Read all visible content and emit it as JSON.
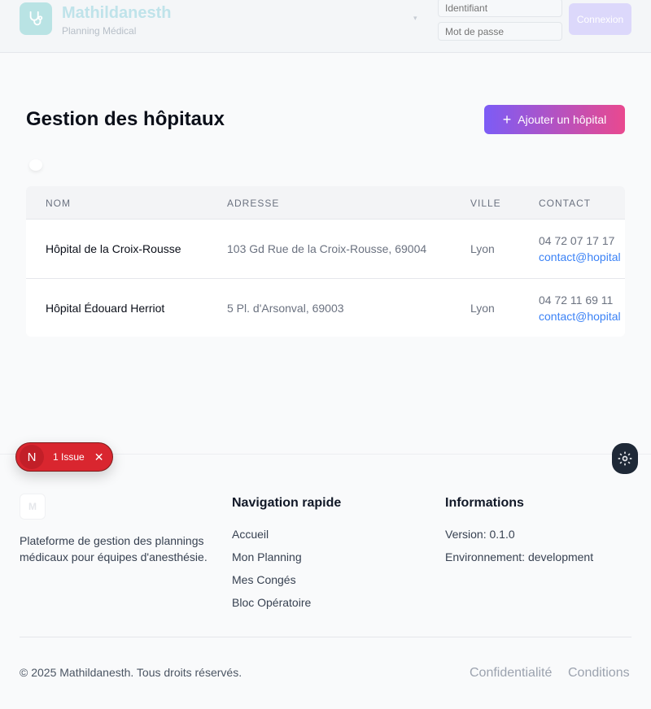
{
  "header": {
    "app_title": "Mathildanesth",
    "app_subtitle": "Planning Médical",
    "username_placeholder": "Identifiant",
    "password_placeholder": "Mot de passe",
    "login_label": "Connexion"
  },
  "page": {
    "title": "Gestion des hôpitaux",
    "add_button_label": "Ajouter un hôpital"
  },
  "table": {
    "headers": [
      "NOM",
      "ADRESSE",
      "VILLE",
      "CONTACT"
    ],
    "rows": [
      {
        "name": "Hôpital de la Croix-Rousse",
        "address": "103 Gd Rue de la Croix-Rousse, 69004",
        "city": "Lyon",
        "phone": "04 72 07 17 17",
        "email": "contact@hopital"
      },
      {
        "name": "Hôpital Édouard Herriot",
        "address": "5 Pl. d'Arsonval, 69003",
        "city": "Lyon",
        "phone": "04 72 11 69 11",
        "email": "contact@hopital"
      }
    ]
  },
  "issue_badge": {
    "letter": "N",
    "text": "1 Issue"
  },
  "footer": {
    "logo_letter": "M",
    "description": "Plateforme de gestion des plannings médicaux pour équipes d'anesthésie.",
    "nav_title": "Navigation rapide",
    "nav_links": [
      "Accueil",
      "Mon Planning",
      "Mes Congés",
      "Bloc Opératoire"
    ],
    "info_title": "Informations",
    "info_items": [
      "Version: 0.1.0",
      "Environnement: development"
    ],
    "copyright": "© 2025 Mathildanesth. Tous droits réservés.",
    "legal_links": [
      "Confidentialité",
      "Conditions"
    ]
  },
  "colors": {
    "accent_gradient_start": "#7c5cf6",
    "accent_gradient_end": "#e9498f",
    "link": "#3b82f6",
    "issue_red": "#d9262f"
  },
  "icons": [
    "stethoscope-icon",
    "chevron-down-icon",
    "plus-icon",
    "close-icon",
    "gear-icon"
  ]
}
